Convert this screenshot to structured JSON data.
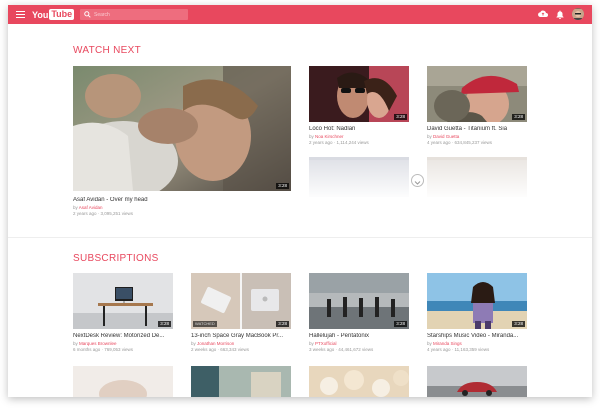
{
  "header": {
    "logo_you": "You",
    "logo_tube": "Tube",
    "search_placeholder": "Search"
  },
  "colors": {
    "accent": "#e8485e"
  },
  "watch_next": {
    "title": "WATCH NEXT",
    "featured": {
      "title": "Asaf Avidan - Over my head",
      "by": "by",
      "channel": "Asaf Avidan",
      "meta": "2 years ago · 3,095,251 views",
      "duration": "3:28"
    },
    "videos": [
      {
        "title": "Loco Hot: Nadlan",
        "by": "by",
        "channel": "Noa Kirschner",
        "meta": "2 years ago · 1,114,244 views",
        "duration": "3:28"
      },
      {
        "title": "David Guetta - Titanium ft. Sia",
        "by": "by",
        "channel": "David Guetta",
        "meta": "4 years ago · 634,845,237 views",
        "duration": "3:28"
      }
    ]
  },
  "subscriptions": {
    "title": "SUBSCRIPTIONS",
    "videos": [
      {
        "title": "NextDesk Review: Motorized De...",
        "by": "by",
        "channel": "Marques Brownlee",
        "meta": "6 months ago · 769,053 views",
        "duration": "3:28",
        "watched": ""
      },
      {
        "title": "13-inch Space Gray MacBook Pr...",
        "by": "by",
        "channel": "Jonathan Morrison",
        "meta": "2 weeks ago · 663,343 views",
        "duration": "3:28",
        "watched": "WATCHED"
      },
      {
        "title": "Hallelujah - Pentatonix",
        "by": "by",
        "channel": "PTXofficial",
        "meta": "3 weeks ago · 44,461,672 views",
        "duration": "3:28",
        "watched": ""
      },
      {
        "title": "Starships Music Video - Miranda...",
        "by": "by",
        "channel": "Miranda Sings",
        "meta": "4 years ago · 11,163,359 views",
        "duration": "3:28",
        "watched": ""
      }
    ]
  },
  "icons": [
    "menu-icon",
    "search-icon",
    "upload-icon",
    "bell-icon",
    "avatar",
    "chevron-down-icon"
  ]
}
